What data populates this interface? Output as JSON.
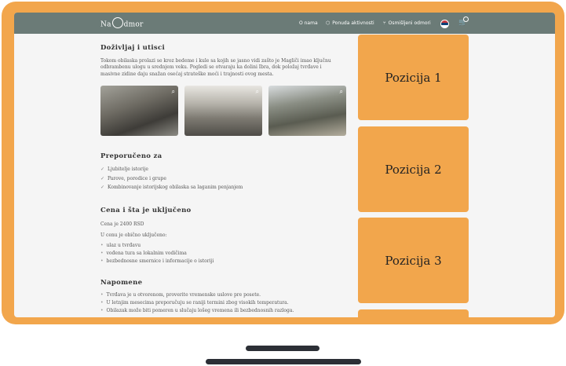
{
  "nav": {
    "logo": "Na dmor",
    "items": [
      {
        "label": "O nama",
        "icon": ""
      },
      {
        "label": "Ponuda aktivnosti",
        "icon": "tag-icon"
      },
      {
        "label": "Osmišljeni odmori",
        "icon": "utensils-icon"
      }
    ],
    "cart_icon": "cart-icon",
    "language_icon": "serbian-flag-icon"
  },
  "section_experience": {
    "title": "Doživljaj i utisci",
    "text": "Tokom obilaska prolazi se kroz bedeme i kule sa kojih se jasno vidi zašto je Magliči imao ključnu odbrambenu ulogu u srednjem veku. Pogledi se otvaraju ka dolini Ibra, dok položaj tvrđave i masivne zidine daju snažan osećaj strateške moći i trajnosti ovog mesta."
  },
  "section_recommended": {
    "title": "Preporučeno za",
    "items": [
      "Ljubitelje istorije",
      "Parove, porodice i grupe",
      "Kombinovanje istorijskog obilaska sa laganim penjanjem"
    ]
  },
  "section_price": {
    "title": "Cena i šta je uključeno",
    "price": "Cena je 2400 RSD",
    "included_label": "U cenu je obično uključeno:",
    "items": [
      "ulaz u tvrđavu",
      "vođena tura sa lokalnim vodičima",
      "bezbednosne smernice i informacije o istoriji"
    ]
  },
  "section_notes": {
    "title": "Napomene",
    "items": [
      "Tvrđava je u otvorenom, proverite vremenske uslove pre posete.",
      "U letnjim mesecima preporučuju se raniji termini zbog visokih temperatura.",
      "Obilazak može biti pomeren u slučaju lošeg vremena ili bezbednosnih razloga."
    ]
  },
  "ads": [
    "Pozicija 1",
    "Pozicija 2",
    "Pozicija 3"
  ],
  "colors": {
    "nav": "#6b7b77",
    "accent": "#f2a64c",
    "background": "#f5f5f5"
  }
}
